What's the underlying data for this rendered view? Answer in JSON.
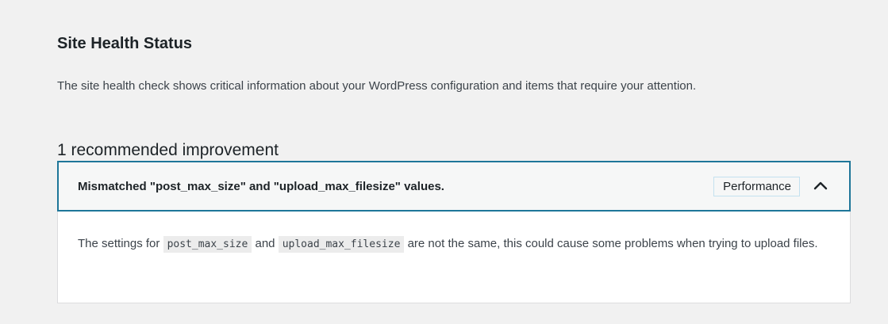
{
  "page": {
    "title": "Site Health Status",
    "description": "The site health check shows critical information about your WordPress configuration and items that require your attention.",
    "recommended_count_text": "1 recommended improvement"
  },
  "issue": {
    "label": "Mismatched \"post_max_size\" and \"upload_max_filesize\" values.",
    "badge": "Performance",
    "toggle_icon": "chevron-up-icon",
    "description_before": "The settings for",
    "code_1": "post_max_size",
    "joiner": "and",
    "code_2": "upload_max_filesize",
    "description_after": "are not the same, this could cause some problems when trying to upload files."
  },
  "colors": {
    "accent_border": "#1e7699",
    "badge_border": "#c3e1ef",
    "page_background": "#f1f1f1",
    "panel_background": "#ffffff"
  }
}
